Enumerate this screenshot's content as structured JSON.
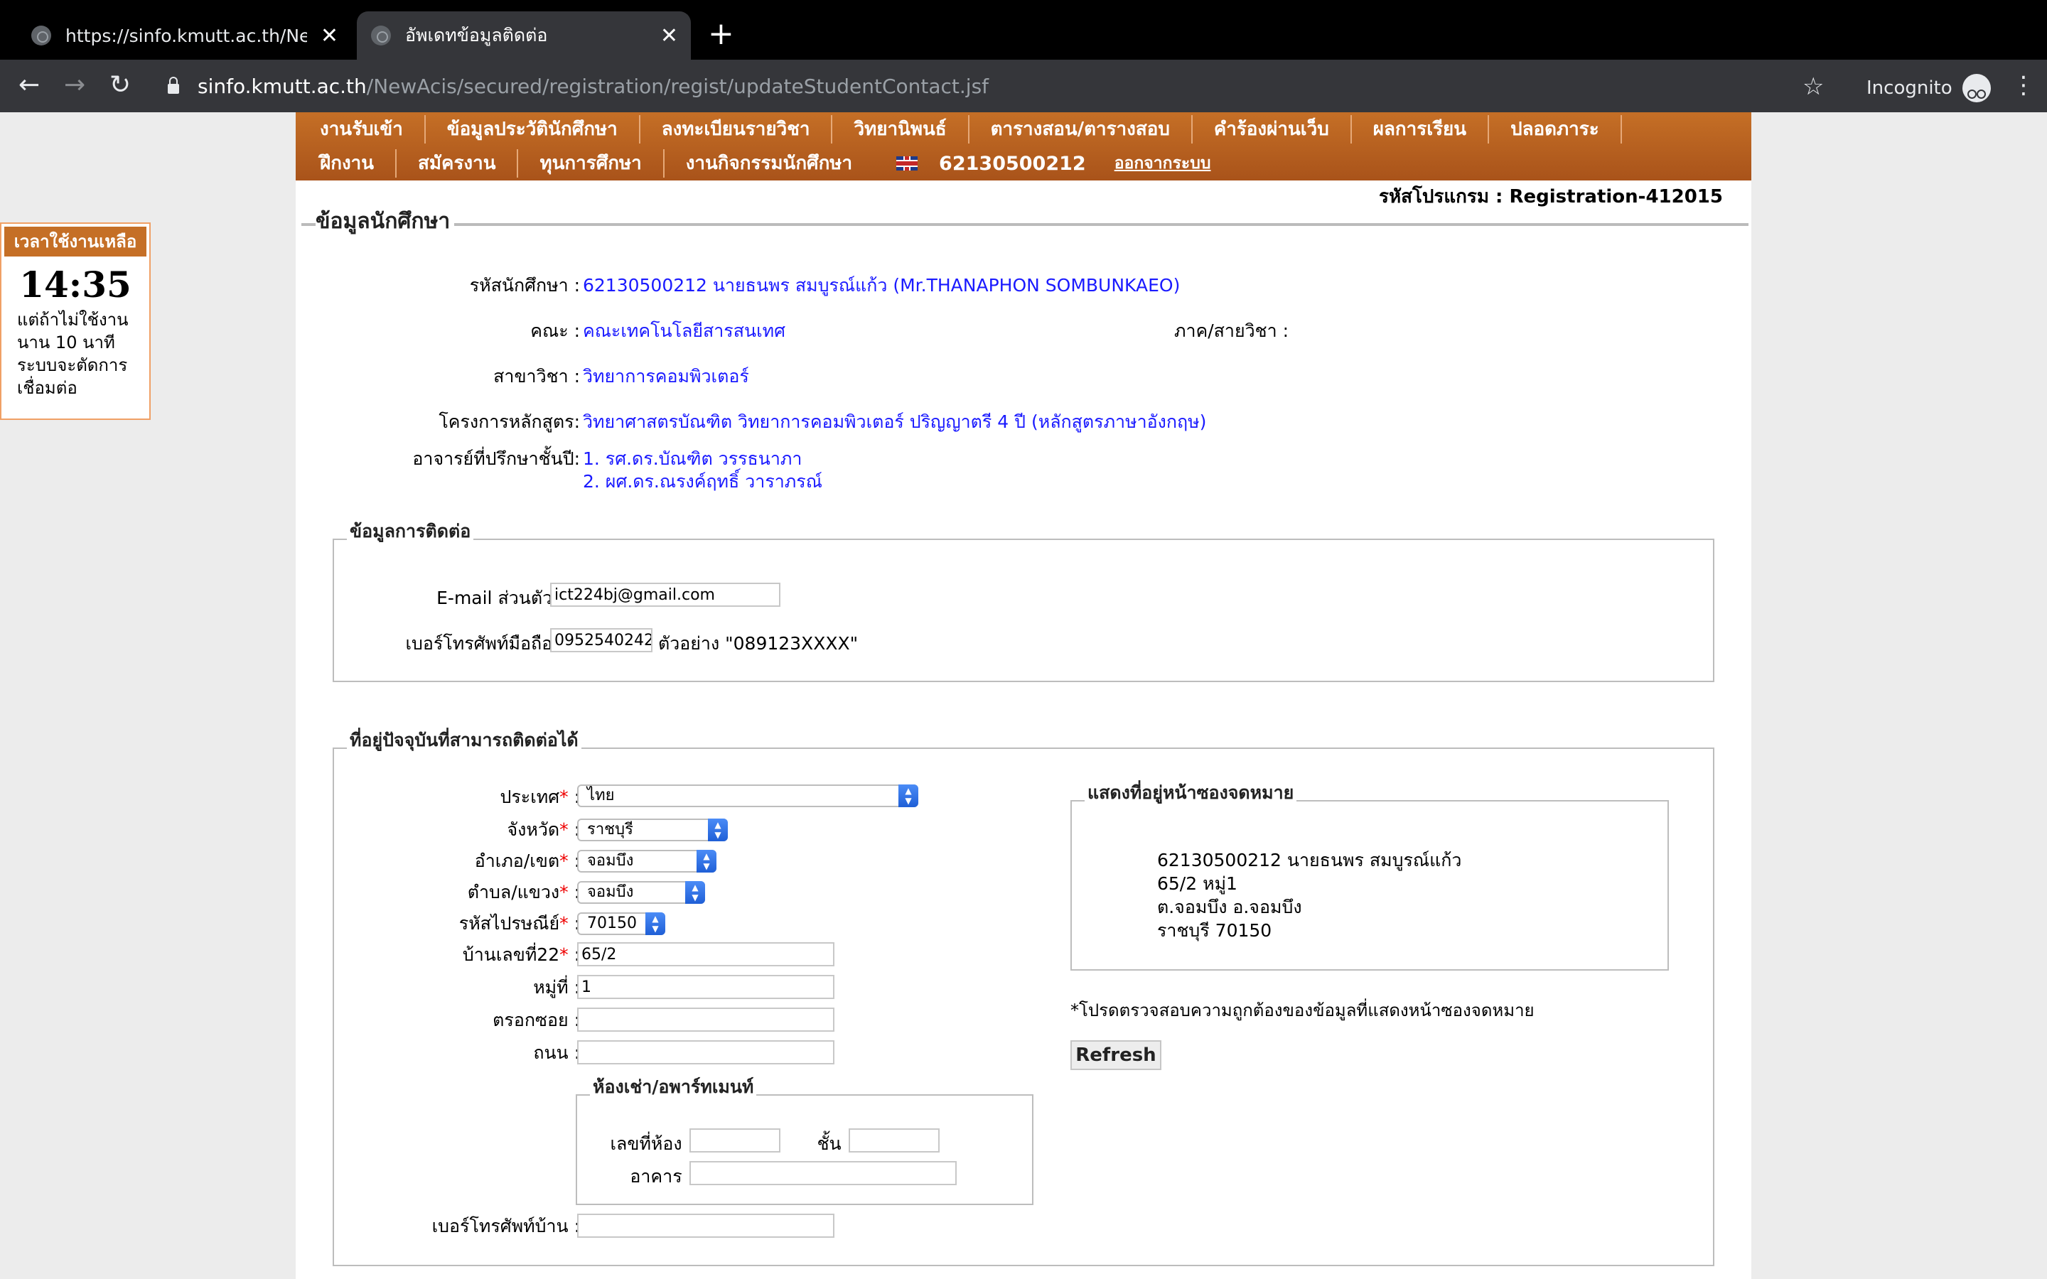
{
  "browser": {
    "tabs": [
      {
        "title": "https://sinfo.kmutt.ac.th/NewAci",
        "active": false
      },
      {
        "title": "อัพเดทข้อมูลติดต่อ",
        "active": true
      }
    ],
    "url_host": "sinfo.kmutt.ac.th",
    "url_path": "/NewAcis/secured/registration/regist/updateStudentContact.jsf",
    "incognito_label": "Incognito"
  },
  "menu": {
    "row1": [
      "งานรับเข้า",
      "ข้อมูลประวัตินักศึกษา",
      "ลงทะเบียนรายวิชา",
      "วิทยานิพนธ์",
      "ตารางสอน/ตารางสอบ",
      "คำร้องผ่านเว็บ",
      "ผลการเรียน",
      "ปลอดภาระ"
    ],
    "row2": [
      "ฝึกงาน",
      "สมัครงาน",
      "ทุนการศึกษา",
      "งานกิจกรรมนักศึกษา"
    ],
    "student_id": "62130500212",
    "logout": "ออกจากระบบ"
  },
  "program_code": "รหัสโปรแกรม : Registration-412015",
  "timer": {
    "header": "เวลาใช้งานเหลือ",
    "time": "14:35",
    "message_lines": [
      "แต่ถ้าไม่ใช้งาน",
      "นาน 10 นาที",
      "ระบบจะตัดการ",
      "เชื่อมต่อ"
    ]
  },
  "student_info": {
    "section_title": "ข้อมูลนักศึกษา",
    "id_label": "รหัสนักศึกษา :",
    "id_value": "62130500212 นายธนพร สมบูรณ์แก้ว (Mr.THANAPHON SOMBUNKAEO)",
    "faculty_label": "คณะ :",
    "faculty_value": "คณะเทคโนโลยีสารสนเทศ",
    "department_label": "ภาค/สายวิชา :",
    "major_label": "สาขาวิชา :",
    "major_value": "วิทยาการคอมพิวเตอร์",
    "curriculum_label": "โครงการหลักสูตร:",
    "curriculum_value": "วิทยาศาสตรบัณฑิต วิทยาการคอมพิวเตอร์ ปริญญาตรี 4 ปี (หลักสูตรภาษาอังกฤษ)",
    "advisor_label": "อาจารย์ที่ปรึกษาชั้นปี:",
    "advisors": [
      "1. รศ.ดร.บัณฑิต วรรธนาภา",
      "2. ผศ.ดร.ณรงค์ฤทธิ์ วาราภรณ์"
    ]
  },
  "contact": {
    "legend": "ข้อมูลการติดต่อ",
    "email_label": "E-mail ส่วนตัว",
    "email_value": "ict224bj@gmail.com",
    "phone_label": "เบอร์โทรศัพท์มือถือ",
    "phone_value": "0952540242",
    "phone_example": "ตัวอย่าง \"089123XXXX\""
  },
  "address": {
    "legend": "ที่อยู่ปัจจุบันที่สามารถติดต่อได้",
    "country_label": "ประเทศ",
    "country_value": "ไทย",
    "province_label": "จังหวัด",
    "province_value": "ราชบุรี",
    "district_label": "อำเภอ/เขต",
    "district_value": "จอมบึง",
    "subdistrict_label": "ตำบล/แขวง",
    "subdistrict_value": "จอมบึง",
    "postcode_label": "รหัสไปรษณีย์",
    "postcode_value": "70150",
    "house_label": "บ้านเลขที่22",
    "house_value": "65/2",
    "moo_label": "หมู่ที่ :",
    "moo_value": "1",
    "soi_label": "ตรอกซอย :",
    "soi_value": "",
    "road_label": "ถนน :",
    "road_value": "",
    "apartment_legend": "ห้องเช่า/อพาร์ทเมนท์",
    "room_label": "เลขที่ห้อง :",
    "floor_label": "ชั้น :",
    "building_label": "อาคาร :",
    "home_phone_label": "เบอร์โทรศัพท์บ้าน :",
    "envelope_legend": "แสดงที่อยู่หน้าซองจดหมาย",
    "envelope_lines": [
      "62130500212 นายธนพร สมบูรณ์แก้ว",
      "65/2 หมู่1",
      "ต.จอมบึง อ.จอมบึง",
      "ราชบุรี 70150"
    ],
    "verify_note": "*โปรดตรวจสอบความถูกต้องของข้อมูลที่แสดงหน้าซองจดหมาย",
    "refresh_label": "Refresh"
  }
}
